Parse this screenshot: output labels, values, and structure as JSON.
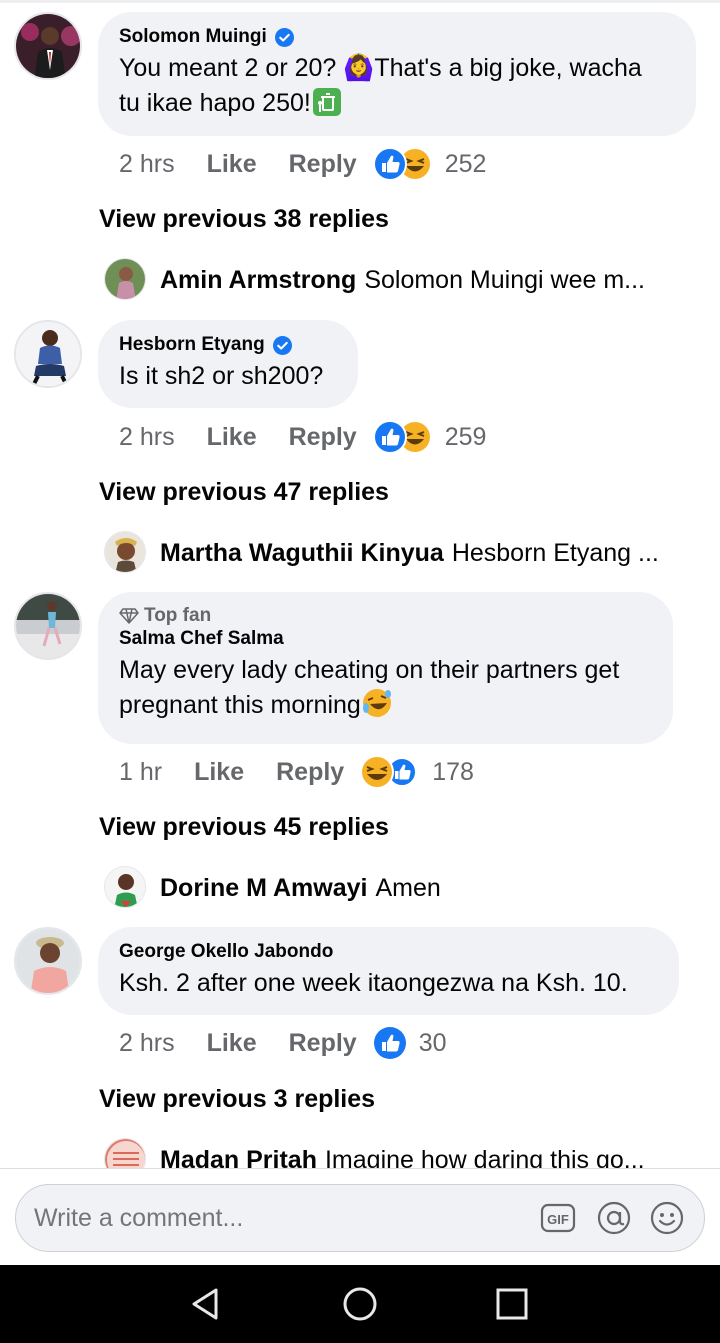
{
  "comments": [
    {
      "author": "Solomon Muingi",
      "verified": true,
      "text_line1": "You meant 2 or 20? 🙆‍♀️That's a big joke, wacha",
      "text_line2": "tu ikae hapo 250!",
      "time": "2 hrs",
      "like": "Like",
      "reply": "Reply",
      "reaction_count": "252",
      "view_previous": "View previous 38 replies",
      "last_reply_name": "Amin Armstrong",
      "last_reply_text": "Solomon Muingi wee m..."
    },
    {
      "author": "Hesborn Etyang",
      "verified": true,
      "text_line1": "Is it sh2 or sh200?",
      "time": "2 hrs",
      "like": "Like",
      "reply": "Reply",
      "reaction_count": "259",
      "view_previous": "View previous 47 replies",
      "last_reply_name": "Martha Waguthii Kinyua",
      "last_reply_text": "Hesborn Etyang ..."
    },
    {
      "badge": "Top fan",
      "author": "Salma Chef Salma",
      "text_line1": "May every lady cheating on their partners get",
      "text_line2": "pregnant this morning",
      "time": "1 hr",
      "like": "Like",
      "reply": "Reply",
      "reaction_count": "178",
      "view_previous": "View previous 45 replies",
      "last_reply_name": "Dorine M Amwayi",
      "last_reply_text": "Amen"
    },
    {
      "author": "George Okello Jabondo",
      "text_line1": "Ksh. 2 after one week itaongezwa na Ksh. 10.",
      "time": "2 hrs",
      "like": "Like",
      "reply": "Reply",
      "reaction_count": "30",
      "view_previous": "View previous 3 replies",
      "last_reply_name": "Madan Pritah",
      "last_reply_text": "Imagine how daring this go..."
    }
  ],
  "composer": {
    "placeholder": "Write a comment..."
  },
  "icons": {
    "verified": "verified-badge-icon",
    "like_reaction": "like-reaction-icon",
    "haha_reaction": "haha-reaction-icon",
    "gif": "gif-icon",
    "mention": "mention-icon",
    "emoji": "emoji-icon",
    "back": "back-nav-icon",
    "home": "home-nav-icon",
    "recents": "recents-nav-icon"
  },
  "colors": {
    "accent": "#1877f2",
    "bubble": "#f0f2f5",
    "secondary_text": "#65676b"
  }
}
